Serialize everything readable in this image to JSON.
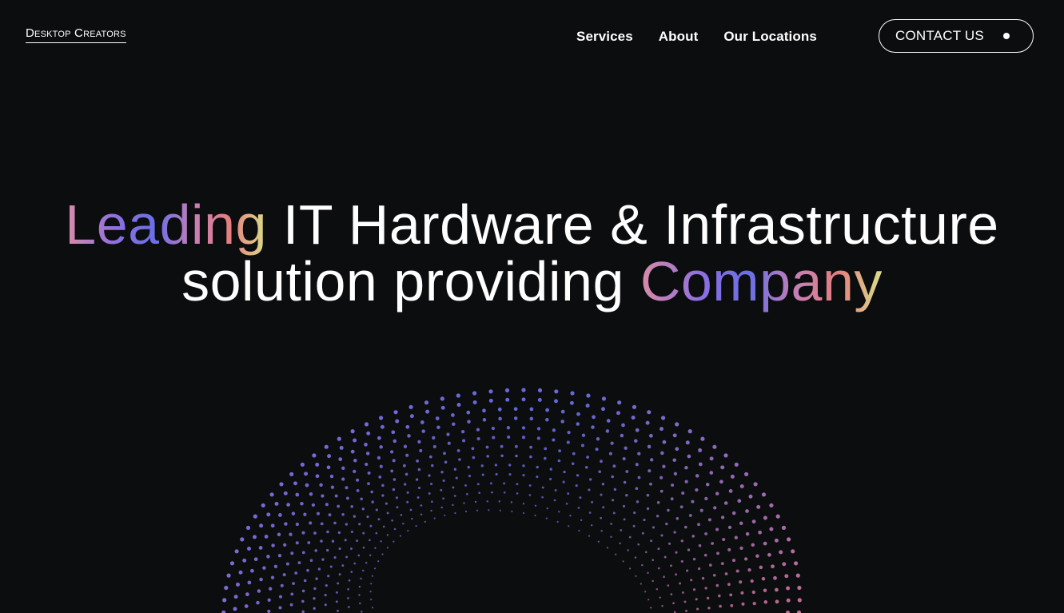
{
  "header": {
    "logo_first": "Desktop",
    "logo_second": "Creators",
    "nav": [
      "Services",
      "About",
      "Our Locations"
    ],
    "contact_label": "CONTACT US"
  },
  "hero": {
    "line1_accent": "Leading",
    "line1_rest": " IT Hardware & Infrastructure",
    "line2_start": "solution providing ",
    "line2_accent": "Company"
  },
  "colors": {
    "background": "#0c0d0f",
    "text": "#ffffff",
    "gradient": [
      "#d98ca6",
      "#8d6fe0",
      "#6a6fe6",
      "#c97fb3",
      "#e57f7f",
      "#d9e089"
    ]
  },
  "icons": {
    "contact_dot": "dot-icon"
  }
}
